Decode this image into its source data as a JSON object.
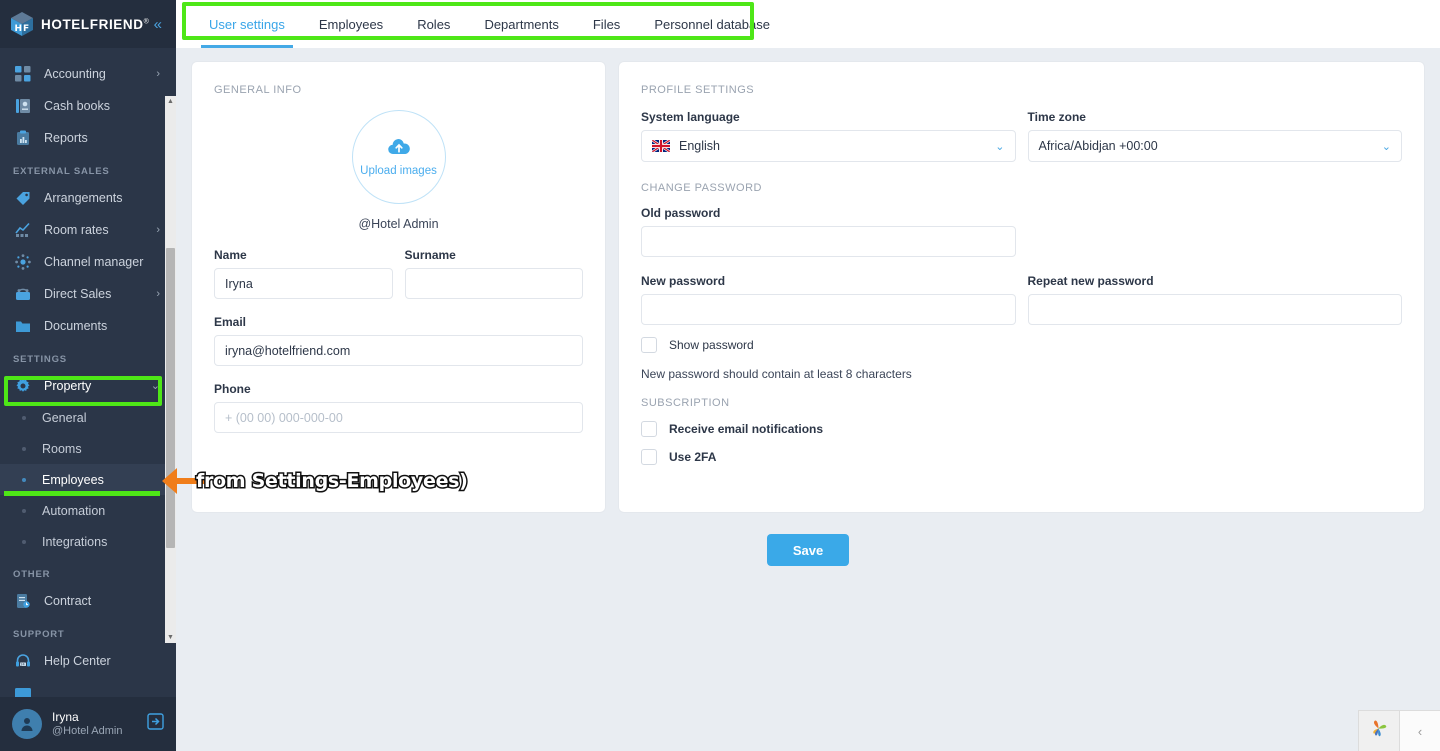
{
  "brand": {
    "name": "HOTELFRIEND",
    "registered": "®",
    "collapse_icon": "chevron-double-left-icon"
  },
  "sidebar": {
    "items": [
      {
        "label": "Accounting",
        "icon": "accounting-icon",
        "has_chevron": true,
        "type": "item"
      },
      {
        "label": "Cash books",
        "icon": "cash-books-icon",
        "has_chevron": false,
        "type": "item"
      },
      {
        "label": "Reports",
        "icon": "reports-icon",
        "has_chevron": false,
        "type": "item"
      },
      {
        "label": "EXTERNAL SALES",
        "type": "group"
      },
      {
        "label": "Arrangements",
        "icon": "tag-icon",
        "has_chevron": false,
        "type": "item"
      },
      {
        "label": "Room rates",
        "icon": "chart-up-icon",
        "has_chevron": true,
        "type": "item"
      },
      {
        "label": "Channel manager",
        "icon": "channel-manager-icon",
        "has_chevron": false,
        "type": "item"
      },
      {
        "label": "Direct Sales",
        "icon": "direct-sales-icon",
        "has_chevron": true,
        "type": "item"
      },
      {
        "label": "Documents",
        "icon": "folder-icon",
        "has_chevron": false,
        "type": "item"
      },
      {
        "label": "SETTINGS",
        "type": "group"
      },
      {
        "label": "Property",
        "icon": "gear-icon",
        "has_chevron": true,
        "type": "item",
        "expanded": true,
        "highlighted": true
      },
      {
        "label": "General",
        "type": "sub"
      },
      {
        "label": "Rooms",
        "type": "sub"
      },
      {
        "label": "Employees",
        "type": "sub",
        "active": true,
        "highlighted": true
      },
      {
        "label": "Automation",
        "type": "sub"
      },
      {
        "label": "Integrations",
        "type": "sub"
      },
      {
        "label": "OTHER",
        "type": "group"
      },
      {
        "label": "Contract",
        "icon": "contract-icon",
        "has_chevron": false,
        "type": "item"
      },
      {
        "label": "SUPPORT",
        "type": "group"
      },
      {
        "label": "Help Center",
        "icon": "headset-icon",
        "has_chevron": false,
        "type": "item"
      }
    ],
    "user": {
      "name": "Iryna",
      "role": "@Hotel Admin",
      "logout_icon": "logout-icon",
      "avatar_icon": "user-avatar-icon"
    }
  },
  "tabs": [
    {
      "label": "User settings",
      "active": true
    },
    {
      "label": "Employees",
      "active": false
    },
    {
      "label": "Roles",
      "active": false
    },
    {
      "label": "Departments",
      "active": false
    },
    {
      "label": "Files",
      "active": false
    },
    {
      "label": "Personnel database",
      "active": false
    }
  ],
  "general_info": {
    "caption": "GENERAL INFO",
    "upload": {
      "label": "Upload images",
      "icon": "cloud-upload-icon"
    },
    "handle": "@Hotel Admin",
    "fields": {
      "name": {
        "label": "Name",
        "value": "Iryna",
        "placeholder": ""
      },
      "surname": {
        "label": "Surname",
        "value": "",
        "placeholder": ""
      },
      "email": {
        "label": "Email",
        "value": "iryna@hotelfriend.com",
        "placeholder": ""
      },
      "phone": {
        "label": "Phone",
        "value": "",
        "placeholder": "+ (00 00) 000-000-00"
      }
    }
  },
  "profile_settings": {
    "caption": "PROFILE SETTINGS",
    "system_language": {
      "label": "System language",
      "value": "English",
      "flag": "uk-flag-icon"
    },
    "time_zone": {
      "label": "Time zone",
      "value": "Africa/Abidjan +00:00"
    },
    "change_password": {
      "caption": "CHANGE PASSWORD",
      "old_password": {
        "label": "Old password",
        "value": "",
        "placeholder": ""
      },
      "new_password": {
        "label": "New password",
        "value": "",
        "placeholder": ""
      },
      "repeat_password": {
        "label": "Repeat new password",
        "value": "",
        "placeholder": ""
      },
      "show_password": {
        "label": "Show password",
        "checked": false
      },
      "hint": "New password should contain at least 8 characters"
    },
    "subscription": {
      "caption": "SUBSCRIPTION",
      "options": [
        {
          "label": "Receive email notifications",
          "checked": false,
          "bold": true
        },
        {
          "label": "Use 2FA",
          "checked": false,
          "bold": false
        }
      ]
    }
  },
  "save_button": {
    "label": "Save"
  },
  "bottom_right": {
    "widget_icon": "pinwheel-icon",
    "collapse_icon": "chevron-left-icon"
  },
  "annotations": {
    "note_text": "from Settings-Employees)",
    "highlight_color": "#4ee717",
    "arrow_color": "#f07d1a"
  },
  "colors": {
    "sidebar_bg": "#2b3648",
    "sidebar_header_bg": "#242e3e",
    "accent": "#3aa9e8",
    "page_bg": "#e9edf2",
    "card_bg": "#ffffff"
  }
}
